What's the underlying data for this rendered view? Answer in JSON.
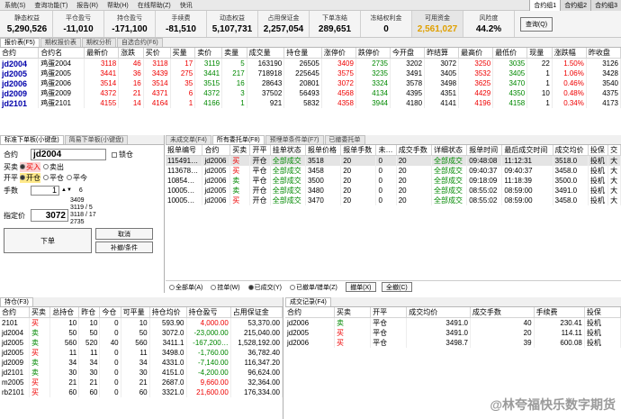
{
  "menu": [
    "系统(S)",
    "查询功能(T)",
    "报告(R)",
    "帮助(H)",
    "在线帮助(Z)",
    "快讯"
  ],
  "menu_right": [
    "合约组1",
    "合约组2",
    "合约组3"
  ],
  "stats": [
    {
      "label": "静态权益",
      "value": "5,290,526"
    },
    {
      "label": "平仓盈亏",
      "value": "-11,010"
    },
    {
      "label": "持仓盈亏",
      "value": "-171,100"
    },
    {
      "label": "手续费",
      "value": "-81,510"
    },
    {
      "label": "动态权益",
      "value": "5,107,731"
    },
    {
      "label": "占用保证金",
      "value": "2,257,054"
    },
    {
      "label": "下单冻结",
      "value": "289,651"
    },
    {
      "label": "冻结权利金",
      "value": "0"
    },
    {
      "label": "可用资金",
      "value": "2,561,027"
    },
    {
      "label": "风险度",
      "value": "44.2%"
    }
  ],
  "refresh_label": "查询(Q)",
  "quote_tabs": [
    "报价表(F5)",
    "期权报价表",
    "期权分析",
    "自选合约(F6)"
  ],
  "quote_headers": [
    "合约",
    "合约名",
    "最新价",
    "涨跌",
    "买价",
    "买量",
    "卖价",
    "卖量",
    "成交量",
    "持仓量",
    "涨停价",
    "跌停价",
    "今开盘",
    "昨结算",
    "最高价",
    "最低价",
    "现量",
    "涨跌幅",
    "昨收盘"
  ],
  "quotes": [
    [
      "jd2004",
      "鸡蛋2004",
      "3118",
      "46",
      "3118",
      "17",
      "3119",
      "5",
      "163190",
      "26505",
      "3409",
      "2735",
      "3202",
      "3072",
      "3250",
      "3035",
      "22",
      "1.50%",
      "3126"
    ],
    [
      "jd2005",
      "鸡蛋2005",
      "3441",
      "36",
      "3439",
      "275",
      "3441",
      "217",
      "718918",
      "225645",
      "3575",
      "3235",
      "3491",
      "3405",
      "3532",
      "3405",
      "1",
      "1.06%",
      "3428"
    ],
    [
      "jd2006",
      "鸡蛋2006",
      "3514",
      "16",
      "3514",
      "35",
      "3515",
      "16",
      "28643",
      "20801",
      "3072",
      "3324",
      "3578",
      "3498",
      "3625",
      "3470",
      "1",
      "0.46%",
      "3540"
    ],
    [
      "jd2009",
      "鸡蛋2009",
      "4372",
      "21",
      "4371",
      "6",
      "4372",
      "3",
      "37502",
      "56493",
      "4568",
      "4134",
      "4395",
      "4351",
      "4429",
      "4350",
      "10",
      "0.48%",
      "4375"
    ],
    [
      "jd2101",
      "鸡蛋2101",
      "4155",
      "14",
      "4164",
      "1",
      "4166",
      "1",
      "921",
      "5832",
      "4358",
      "3944",
      "4180",
      "4141",
      "4196",
      "4158",
      "1",
      "0.34%",
      "4173"
    ]
  ],
  "order": {
    "tabs": [
      "标准下单板(小键盘)",
      "简易下单板(小键盘)"
    ],
    "code_label": "合约",
    "code": "jd2004",
    "lock_label": "锁仓",
    "dir_label": "买卖",
    "buy": "买入",
    "sell": "卖出",
    "oc_label": "开平",
    "open": "开仓",
    "close": "平仓",
    "close_today": "平今",
    "qty_label": "手数",
    "qty": "1",
    "price_label": "指定价",
    "price": "3072",
    "side_info": [
      "6",
      "3409",
      "3119 / 5",
      "3118 / 17",
      "2735"
    ],
    "submit_label": "下单",
    "cancel_label": "取消",
    "chase_label": "补撤/条件"
  },
  "ord_tabs": [
    "未成交单(F4)",
    "所有委托单(F8)",
    "预埋单条件单(F7)",
    "已撤委托单"
  ],
  "ord_headers": [
    "报单编号",
    "合约",
    "买卖",
    "开平",
    "挂单状态",
    "报单价格",
    "报单手数",
    "未…",
    "成交手数",
    "详细状态",
    "报单时间",
    "最后成交时间",
    "成交均价",
    "投保",
    "交"
  ],
  "orders": [
    [
      "115491…",
      "jd2006",
      "买",
      "开仓",
      "全部成交",
      "3518",
      "20",
      "0",
      "20",
      "全部成交",
      "09:48:08",
      "11:12:31",
      "3518.0",
      "投机",
      "大"
    ],
    [
      "113678…",
      "jd2005",
      "买",
      "平仓",
      "全部成交",
      "3458",
      "20",
      "0",
      "20",
      "全部成交",
      "09:40:37",
      "09:40:37",
      "3458.0",
      "投机",
      "大"
    ],
    [
      "10854…",
      "jd2006",
      "卖",
      "平仓",
      "全部成交",
      "3500",
      "20",
      "0",
      "20",
      "全部成交",
      "09:18:09",
      "11:18:39",
      "3500.0",
      "投机",
      "大"
    ],
    [
      "10005…",
      "jd2005",
      "卖",
      "开仓",
      "全部成交",
      "3480",
      "20",
      "0",
      "20",
      "全部成交",
      "08:55:02",
      "08:59:00",
      "3491.0",
      "投机",
      "大"
    ],
    [
      "10005…",
      "jd2006",
      "买",
      "开仓",
      "全部成交",
      "3470",
      "20",
      "0",
      "20",
      "全部成交",
      "08:55:02",
      "08:59:00",
      "3458.0",
      "投机",
      "大"
    ]
  ],
  "ord_footer": {
    "all": "全部单(A)",
    "hang": "挂单(W)",
    "done": "已成交(Y)",
    "cancel": "已撤单/错单(Z)",
    "cancel_btn": "撤单(X)",
    "cancel_all_btn": "全撤(C)"
  },
  "pos_tab": "持仓(F3)",
  "pos_headers": [
    "合约",
    "买卖",
    "总持仓",
    "昨仓",
    "今仓",
    "可平量",
    "持仓均价",
    "持仓盈亏",
    "占用保证金"
  ],
  "positions": [
    [
      "2101",
      "买",
      "10",
      "10",
      "0",
      "10",
      "593.90",
      "4,000.00",
      "53,370.00"
    ],
    [
      "jd2004",
      "卖",
      "50",
      "50",
      "0",
      "50",
      "3072.0",
      "-23,000.00",
      "215,040.00"
    ],
    [
      "jd2005",
      "卖",
      "560",
      "520",
      "40",
      "560",
      "3411.1",
      "-167,200…",
      "1,528,192.00"
    ],
    [
      "jd2005",
      "买",
      "11",
      "11",
      "0",
      "11",
      "3498.0",
      "-1,760.00",
      "36,782.40"
    ],
    [
      "jd2009",
      "卖",
      "34",
      "34",
      "0",
      "34",
      "4331.0",
      "-7,140.00",
      "116,347.20"
    ],
    [
      "jd2101",
      "卖",
      "30",
      "30",
      "0",
      "30",
      "4151.0",
      "-4,200.00",
      "96,624.00"
    ],
    [
      "m2005",
      "买",
      "21",
      "21",
      "0",
      "21",
      "2687.0",
      "9,660.00",
      "32,364.00"
    ],
    [
      "rb2101",
      "买",
      "60",
      "60",
      "0",
      "60",
      "3321.0",
      "21,600.00",
      "176,334.00"
    ]
  ],
  "trade_tab": "成交记录(F4)",
  "trade_headers": [
    "合约",
    "买卖",
    "开平",
    "成交均价",
    "成交手数",
    "手续费",
    "投保"
  ],
  "trades": [
    [
      "jd2006",
      "卖",
      "平仓",
      "3491.0",
      "40",
      "230.41",
      "投机"
    ],
    [
      "jd2005",
      "买",
      "平仓",
      "3491.0",
      "20",
      "114.11",
      "投机"
    ],
    [
      "jd2006",
      "买",
      "平仓",
      "3498.7",
      "39",
      "600.08",
      "投机"
    ]
  ],
  "watermark": "@林夸福快乐数字期货"
}
